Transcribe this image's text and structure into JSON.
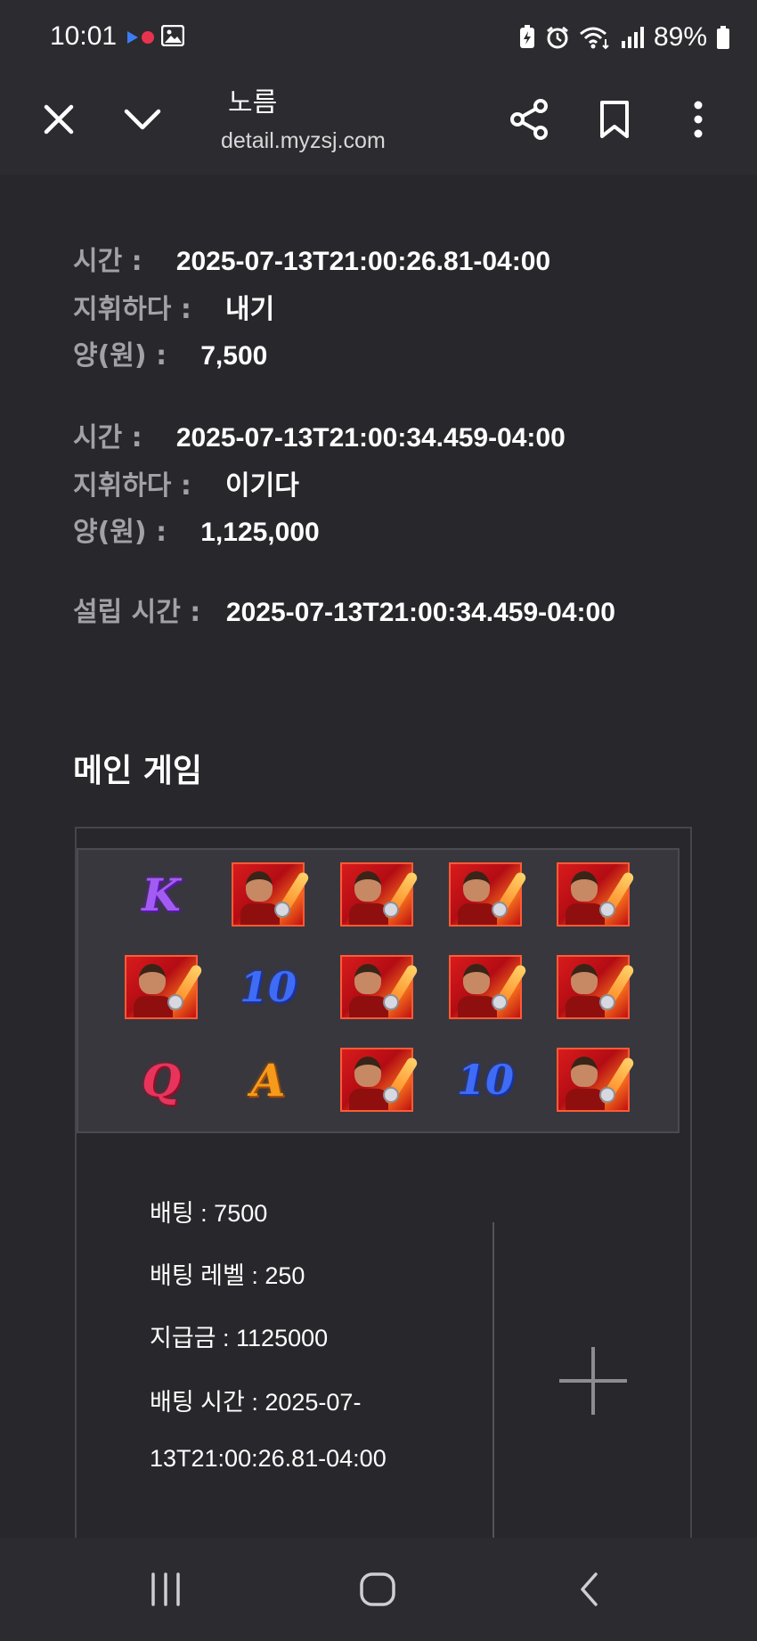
{
  "status_bar": {
    "time": "10:01",
    "battery_percent": "89%",
    "icons": [
      "notification-dots-icon",
      "image-icon",
      "battery-saver-icon",
      "alarm-icon",
      "wifi-icon",
      "signal-icon",
      "battery-icon"
    ]
  },
  "browser": {
    "title": "노름",
    "url": "detail.myzsj.com",
    "icons": [
      "close-icon",
      "chevron-down-icon",
      "share-icon",
      "bookmark-icon",
      "more-icon"
    ]
  },
  "details": {
    "entries": [
      {
        "time_label": "시간 :",
        "time_value": "2025-07-13T21:00:26.81-04:00",
        "action_label": "지휘하다 :",
        "action_value": "내기",
        "amount_label": "양(원) :",
        "amount_value": "7,500"
      },
      {
        "time_label": "시간 :",
        "time_value": "2025-07-13T21:00:34.459-04:00",
        "action_label": "지휘하다 :",
        "action_value": "이기다",
        "amount_label": "양(원) :",
        "amount_value": "1,125,000"
      }
    ],
    "settle_label": "설립 시간 :",
    "settle_value": "2025-07-13T21:00:34.459-04:00"
  },
  "main_game": {
    "title": "메인 게임",
    "reels": [
      [
        "K",
        "hero",
        "hero",
        "hero",
        "hero"
      ],
      [
        "hero",
        "10",
        "hero",
        "hero",
        "hero"
      ],
      [
        "Q",
        "A",
        "hero",
        "10",
        "hero"
      ]
    ],
    "info": {
      "bet": "배팅 : 7500",
      "bet_level": "배팅 레벨 : 250",
      "payout": "지급금 : 1125000",
      "bet_time_line1": "배팅 시간 : 2025-07-",
      "bet_time_line2": "13T21:00:26.81-04:00"
    }
  },
  "colors": {
    "background": "#28272c",
    "bar": "#2b2b30",
    "label": "#a2a2a6",
    "reel_bg": "#38373d"
  }
}
